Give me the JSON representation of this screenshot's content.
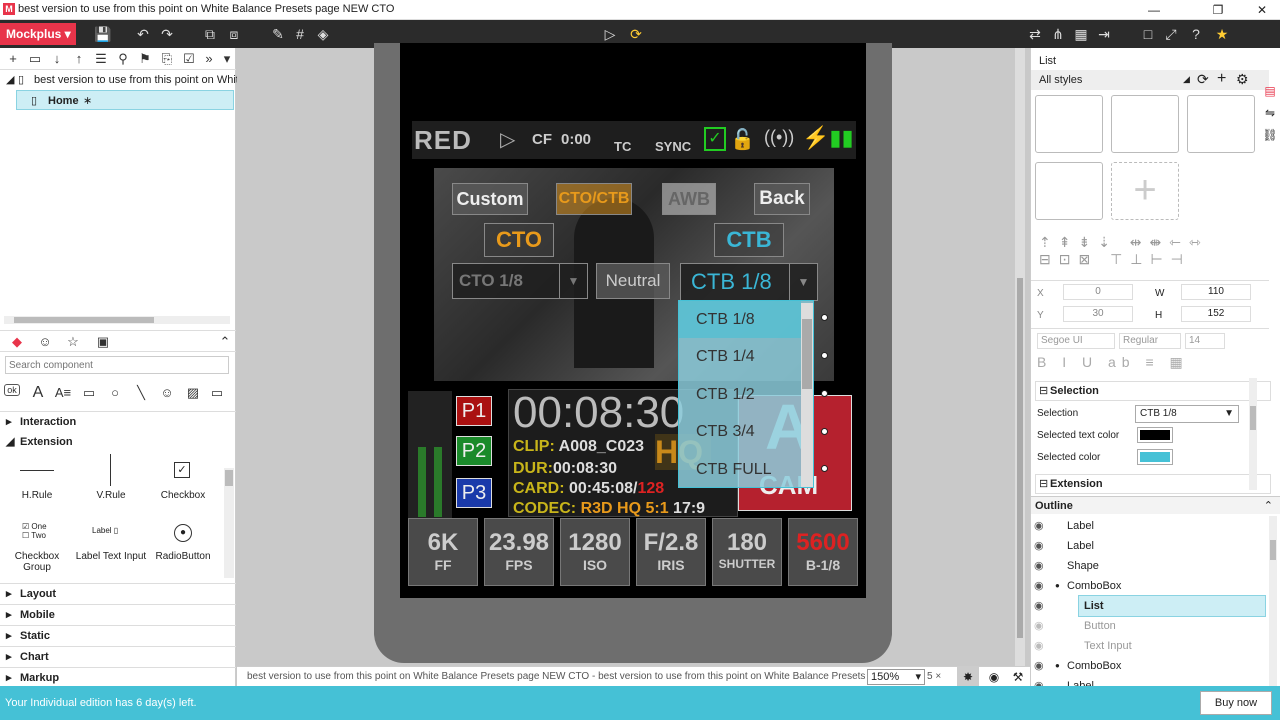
{
  "window": {
    "title": "best version to use from this point on White Balance Presets page NEW CTO",
    "logo": "M",
    "min": "—",
    "restore": "❐",
    "close": "✕"
  },
  "toolbar": {
    "app_button": "Mockplus ▾"
  },
  "pages": {
    "project": "best version to use from this point on White E",
    "home": "Home",
    "home_marker": "∗"
  },
  "components": {
    "search_placeholder": "Search component",
    "categories": {
      "interaction": "Interaction",
      "extension": "Extension",
      "layout": "Layout",
      "mobile": "Mobile",
      "static": "Static",
      "chart": "Chart",
      "markup": "Markup"
    },
    "items": {
      "hrule": "H.Rule",
      "vrule": "V.Rule",
      "checkbox": "Checkbox",
      "checkbox_group": "Checkbox Group",
      "label_text_input": "Label Text Input",
      "radio_button": "RadioButton",
      "one": "One",
      "two": "Two",
      "label_mini": "Label"
    }
  },
  "camera": {
    "brand": "RED",
    "cf": "CF",
    "cf_time": "0:00",
    "tc": "TC",
    "sync": "SYNC",
    "buttons": {
      "custom": "Custom",
      "cto_ctb": "CTO/CTB",
      "awb": "AWB",
      "back": "Back",
      "cto": "CTO",
      "ctb": "CTB",
      "cto_value": "CTO 1/8",
      "neutral": "Neutral",
      "ctb_value": "CTB 1/8"
    },
    "presets": [
      "P1",
      "P2",
      "P3"
    ],
    "timecode": "00:08:30",
    "clip_label": "CLIP:",
    "clip": "A008_C023",
    "dur_label": "DUR:",
    "dur": "00:08:30",
    "card_label": "CARD:",
    "card": "00:45:08/",
    "card_red": "128",
    "codec_label": "CODEC:",
    "codec": "R3D HQ 5:1",
    "codec_ratio": "17:9",
    "hq": "HQ",
    "cam_letter": "A",
    "cam_word": "CAM",
    "stats": [
      {
        "value": "6K",
        "label": "FF"
      },
      {
        "value": "23.98",
        "label": "FPS"
      },
      {
        "value": "1280",
        "label": "ISO"
      },
      {
        "value": "F/2.8",
        "label": "IRIS"
      },
      {
        "value": "180",
        "label": "SHUTTER"
      },
      {
        "value": "5600",
        "label": "B-1/8"
      }
    ],
    "colors": {
      "accent_cto": "#e89a1b",
      "accent_ctb": "#3ab6d6",
      "warn_red": "#d22"
    }
  },
  "dropdown": {
    "selected": "CTB 1/8",
    "items": [
      "CTB 1/8",
      "CTB 1/4",
      "CTB 1/2",
      "CTB 3/4",
      "CTB FULL"
    ]
  },
  "canvas_footer": {
    "path": "best version to use from this point on White Balance Presets page NEW CTO - best version to use from this point on White Balance Presets page NEW CT",
    "zoom": "150%",
    "trail": "5 ×"
  },
  "right": {
    "panel_title": "List",
    "styles": "All styles",
    "x_label": "X",
    "x_value": "0",
    "w_label": "W",
    "w_value": "110",
    "y_label": "Y",
    "y_value": "30",
    "h_label": "H",
    "h_value": "152",
    "font": "Segoe UI",
    "weight": "Regular",
    "size": "14",
    "selection_header": "Selection",
    "selection_label": "Selection",
    "selection_value": "CTB 1/8",
    "selected_text_color_label": "Selected text color",
    "selected_color_label": "Selected color",
    "selected_text_color": "#000000",
    "selected_color": "#45c1d6",
    "extension_header": "Extension",
    "outline_header": "Outline",
    "outline": [
      {
        "label": "Label",
        "dim": false,
        "level": 0,
        "dot": false
      },
      {
        "label": "Label",
        "dim": false,
        "level": 0,
        "dot": false
      },
      {
        "label": "Shape",
        "dim": false,
        "level": 0,
        "dot": false
      },
      {
        "label": "ComboBox",
        "dim": false,
        "level": 0,
        "dot": true
      },
      {
        "label": "List",
        "dim": false,
        "level": 1,
        "dot": false
      },
      {
        "label": "Button",
        "dim": true,
        "level": 1,
        "dot": false
      },
      {
        "label": "Text Input",
        "dim": true,
        "level": 1,
        "dot": false
      },
      {
        "label": "ComboBox",
        "dim": false,
        "level": 0,
        "dot": true
      },
      {
        "label": "Label",
        "dim": false,
        "level": 0,
        "dot": false
      }
    ]
  },
  "status": {
    "message": "Your Individual edition has 6 day(s) left.",
    "buy": "Buy now"
  }
}
